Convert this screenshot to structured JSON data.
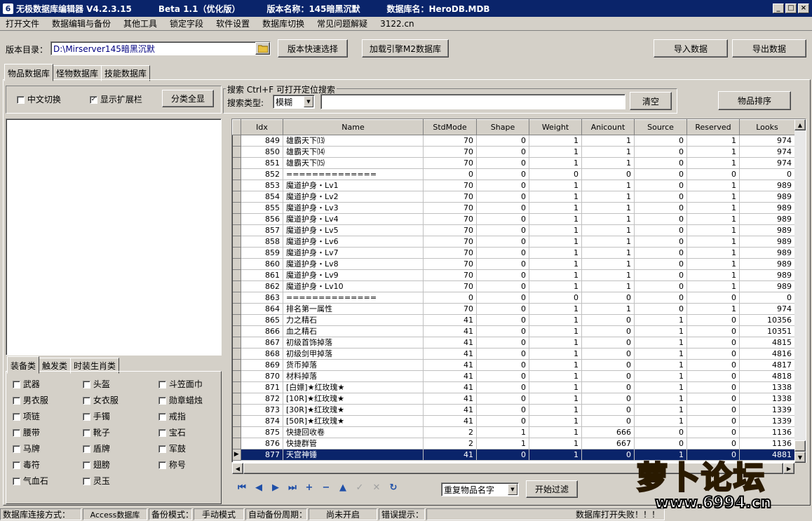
{
  "title": {
    "app": "无极数据库编辑器 V4.2.3.15",
    "beta": "Beta 1.1（优化版）",
    "version_name": "版本名称：145暗黑沉默",
    "db_name": "数据库名：HeroDB.MDB"
  },
  "menu": [
    "打开文件",
    "数据编辑与备份",
    "其他工具",
    "锁定字段",
    "软件设置",
    "数据库切换",
    "常见问题解疑",
    "3122.cn"
  ],
  "toolbar": {
    "dir_label": "版本目录：",
    "dir_value": "D:\\Mirserver145暗黑沉默",
    "quick_select": "版本快速选择",
    "load_m2": "加载引擎M2数据库",
    "import": "导入数据",
    "export": "导出数据"
  },
  "tabs": [
    "物品数据库",
    "怪物数据库",
    "技能数据库"
  ],
  "options": {
    "chinese_switch": "中文切换",
    "show_ext": "显示扩展栏",
    "show_all": "分类全显",
    "search_title": "搜索   Ctrl+F 可打开定位搜索",
    "search_type_label": "搜索类型:",
    "search_type_value": "模糊",
    "clear": "清空",
    "sort": "物品排序"
  },
  "category_tabs": [
    "装备类",
    "触发类",
    "时装生肖类"
  ],
  "categories": [
    "武器",
    "头盔",
    "斗笠面巾",
    "男衣服",
    "女衣服",
    "勋章蜡烛",
    "项链",
    "手镯",
    "戒指",
    "腰带",
    "靴子",
    "宝石",
    "马牌",
    "盾牌",
    "军鼓",
    "毒符",
    "翅膀",
    "称号",
    "气血石",
    "灵玉"
  ],
  "table": {
    "columns": [
      "Idx",
      "Name",
      "StdMode",
      "Shape",
      "Weight",
      "Anicount",
      "Source",
      "Reserved",
      "Looks"
    ],
    "rows": [
      [
        "849",
        "雄霸天下⒀",
        "70",
        "0",
        "1",
        "1",
        "0",
        "1",
        "974"
      ],
      [
        "850",
        "雄霸天下⒁",
        "70",
        "0",
        "1",
        "1",
        "0",
        "1",
        "974"
      ],
      [
        "851",
        "雄霸天下⒂",
        "70",
        "0",
        "1",
        "1",
        "0",
        "1",
        "974"
      ],
      [
        "852",
        "==============",
        "0",
        "0",
        "0",
        "0",
        "0",
        "0",
        "0"
      ],
      [
        "853",
        "魔道护身・Lv1",
        "70",
        "0",
        "1",
        "1",
        "0",
        "1",
        "989"
      ],
      [
        "854",
        "魔道护身・Lv2",
        "70",
        "0",
        "1",
        "1",
        "0",
        "1",
        "989"
      ],
      [
        "855",
        "魔道护身・Lv3",
        "70",
        "0",
        "1",
        "1",
        "0",
        "1",
        "989"
      ],
      [
        "856",
        "魔道护身・Lv4",
        "70",
        "0",
        "1",
        "1",
        "0",
        "1",
        "989"
      ],
      [
        "857",
        "魔道护身・Lv5",
        "70",
        "0",
        "1",
        "1",
        "0",
        "1",
        "989"
      ],
      [
        "858",
        "魔道护身・Lv6",
        "70",
        "0",
        "1",
        "1",
        "0",
        "1",
        "989"
      ],
      [
        "859",
        "魔道护身・Lv7",
        "70",
        "0",
        "1",
        "1",
        "0",
        "1",
        "989"
      ],
      [
        "860",
        "魔道护身・Lv8",
        "70",
        "0",
        "1",
        "1",
        "0",
        "1",
        "989"
      ],
      [
        "861",
        "魔道护身・Lv9",
        "70",
        "0",
        "1",
        "1",
        "0",
        "1",
        "989"
      ],
      [
        "862",
        "魔道护身・Lv10",
        "70",
        "0",
        "1",
        "1",
        "0",
        "1",
        "989"
      ],
      [
        "863",
        "==============",
        "0",
        "0",
        "0",
        "0",
        "0",
        "0",
        "0"
      ],
      [
        "864",
        "排名第一属性",
        "70",
        "0",
        "1",
        "1",
        "0",
        "1",
        "974"
      ],
      [
        "865",
        "力之精石",
        "41",
        "0",
        "1",
        "0",
        "1",
        "0",
        "10356"
      ],
      [
        "866",
        "血之精石",
        "41",
        "0",
        "1",
        "0",
        "1",
        "0",
        "10351"
      ],
      [
        "867",
        "初级首饰掉落",
        "41",
        "0",
        "1",
        "0",
        "1",
        "0",
        "4815"
      ],
      [
        "868",
        "初级剑甲掉落",
        "41",
        "0",
        "1",
        "0",
        "1",
        "0",
        "4816"
      ],
      [
        "869",
        "货币掉落",
        "41",
        "0",
        "1",
        "0",
        "1",
        "0",
        "4817"
      ],
      [
        "870",
        "材料掉落",
        "41",
        "0",
        "1",
        "0",
        "1",
        "0",
        "4818"
      ],
      [
        "871",
        "[白嫖]★红玫瑰★",
        "41",
        "0",
        "1",
        "0",
        "1",
        "0",
        "1338"
      ],
      [
        "872",
        "[10R]★红玫瑰★",
        "41",
        "0",
        "1",
        "0",
        "1",
        "0",
        "1338"
      ],
      [
        "873",
        "[30R]★红玫瑰★",
        "41",
        "0",
        "1",
        "0",
        "1",
        "0",
        "1339"
      ],
      [
        "874",
        "[50R]★红玫瑰★",
        "41",
        "0",
        "1",
        "0",
        "1",
        "0",
        "1339"
      ],
      [
        "875",
        "快捷回收卷",
        "2",
        "1",
        "1",
        "666",
        "0",
        "0",
        "1136"
      ],
      [
        "876",
        "快捷群管",
        "2",
        "1",
        "1",
        "667",
        "0",
        "0",
        "1136"
      ],
      [
        "877",
        "天宫神锤",
        "41",
        "0",
        "1",
        "0",
        "1",
        "0",
        "4881"
      ]
    ],
    "selected_idx": "877"
  },
  "filter": {
    "dup_label": "重复物品名字",
    "start_filter": "开始过滤"
  },
  "status": {
    "conn_label": "数据库连接方式：",
    "conn_value": "Access数据库",
    "backup_label": "备份模式：",
    "backup_value": "手动模式",
    "auto_label": "自动备份周期：",
    "auto_value": "尚未开启",
    "err_label": "错误提示：",
    "err_value": "数据库打开失败！！！"
  },
  "watermark": {
    "text": "萝卜论坛",
    "url": "www.6994.cn"
  }
}
